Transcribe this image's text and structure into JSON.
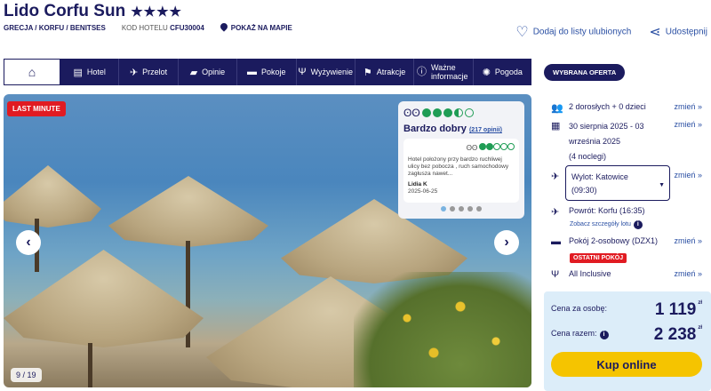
{
  "hotel": {
    "name": "Lido Corfu Sun",
    "stars": "★★★★",
    "location": "GRECJA / KORFU / BENITSES",
    "code_label": "KOD HOTELU",
    "code": "CFU30004",
    "map_link": "POKAŻ NA MAPIE"
  },
  "actions": {
    "favorite": "Dodaj do listy ulubionych",
    "share": "Udostępnij"
  },
  "tabs": [
    {
      "label": "Hotel",
      "icon": "hotel-icon"
    },
    {
      "label": "Przelot",
      "icon": "plane-icon"
    },
    {
      "label": "Opinie",
      "icon": "comment-icon"
    },
    {
      "label": "Pokoje",
      "icon": "bed-icon"
    },
    {
      "label": "Wyżywienie",
      "icon": "cutlery-icon"
    },
    {
      "label": "Atrakcje",
      "icon": "signpost-icon"
    },
    {
      "label": "Ważne informacje",
      "icon": "info-icon"
    },
    {
      "label": "Pogoda",
      "icon": "sun-icon"
    }
  ],
  "gallery": {
    "badge": "LAST MINUTE",
    "counter": "9 / 19",
    "prev": "‹",
    "next": "›"
  },
  "review": {
    "rating_text": "Bardzo dobry",
    "reviews_link": "(217 opinii)",
    "score_circles": 3.5,
    "quote": "Hotel położony przy bardzo ruchliwej ulicy bez pobocza , ruch samochodowy zagłusza nawet...",
    "quote_score_circles": 2,
    "author": "Lidia K",
    "date": "2025-06-25"
  },
  "offer": {
    "header": "WYBRANA OFERTA",
    "change_label": "zmień »",
    "people": "2 dorosłych + 0 dzieci",
    "dates_line1": "30 sierpnia 2025 - 03",
    "dates_line2": "września 2025",
    "nights": "(4 noclegi)",
    "departure_line1": "Wylot: Katowice",
    "departure_line2": "(09:30)",
    "return": "Powrót: Korfu (16:35)",
    "flight_details": "Zobacz szczegóły lotu",
    "room": "Pokój 2-osobowy (DZX1)",
    "last_rooms": "OSTATNI POKÓJ",
    "board": "All Inclusive",
    "price_per_person_label": "Cena za osobę:",
    "price_per_person": "1 119",
    "price_total_label": "Cena razem:",
    "price_total": "2 238",
    "currency": "zł",
    "buy": "Kup online"
  }
}
